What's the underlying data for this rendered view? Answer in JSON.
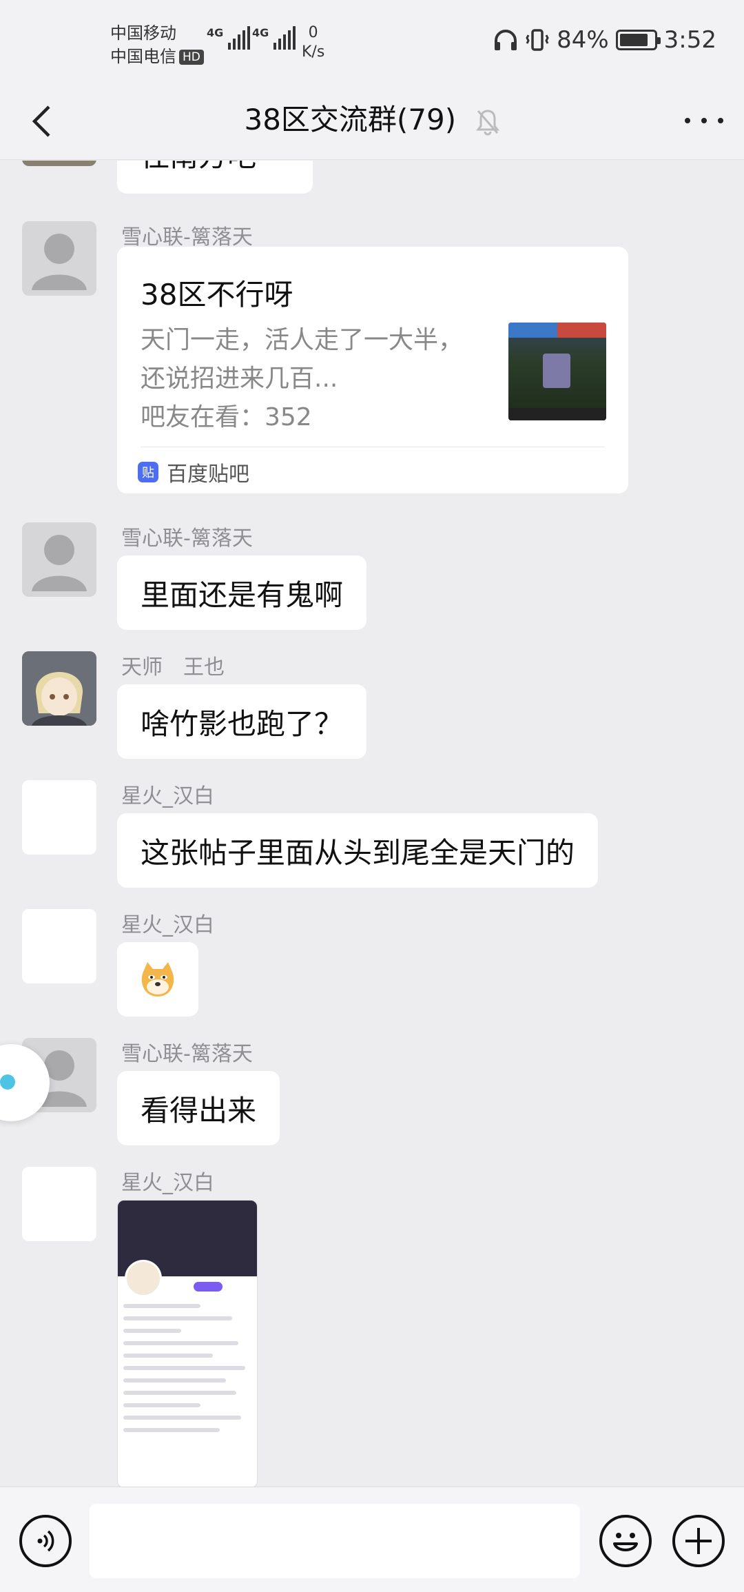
{
  "status_bar": {
    "carrier1": "中国移动",
    "carrier2": "中国电信",
    "hd": "HD",
    "signal1": "4G",
    "signal2": "4G",
    "net_speed_value": "0",
    "net_speed_unit": "K/s",
    "battery_percent": "84%",
    "battery_level": 0.84,
    "time": "3:52"
  },
  "nav": {
    "title": "38区交流群(79)",
    "back_icon": "chevron-left-icon",
    "mute_icon": "bell-off-icon",
    "more_icon": "more-dots-icon"
  },
  "messages": [
    {
      "text": "往南方吧"
    },
    {
      "sender": "雪心联-篱落天",
      "card": {
        "title": "38区不行呀",
        "desc": "天门一走，活人走了一大半，还说招进来几百...",
        "views": "吧友在看：352",
        "source": "百度贴吧",
        "source_logo_text": "贴"
      }
    },
    {
      "sender": "雪心联-篱落天",
      "text": "里面还是有鬼啊"
    },
    {
      "sender": "天师　王也",
      "text": "啥竹影也跑了？"
    },
    {
      "sender": "星火_汉白",
      "text": "这张帖子里面从头到尾全是天门的"
    },
    {
      "sender": "星火_汉白",
      "emoji": "doge-emoji"
    },
    {
      "sender": "雪心联-篱落天",
      "text": "看得出来"
    },
    {
      "sender": "星火_汉白",
      "image": "screenshot-image"
    }
  ],
  "input": {
    "placeholder": "",
    "voice_icon": "voice-icon",
    "emoji_icon": "smile-icon",
    "plus_icon": "plus-icon"
  }
}
